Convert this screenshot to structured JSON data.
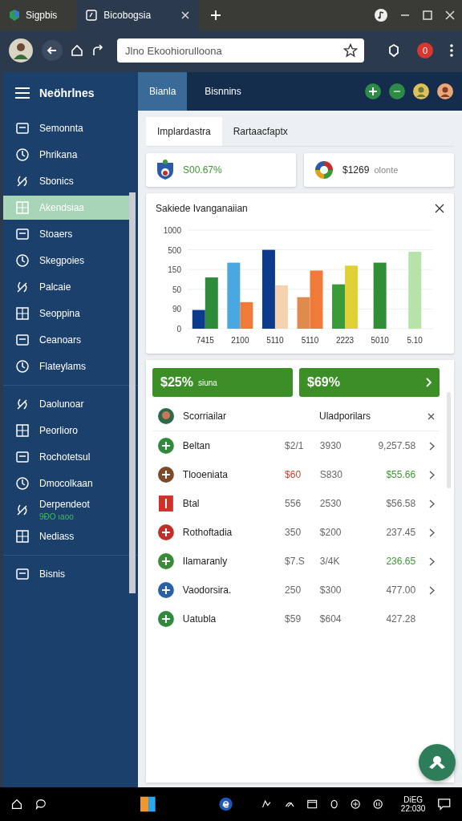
{
  "browser": {
    "tabs": [
      {
        "label": "Sigpbis",
        "selected": false
      },
      {
        "label": "Bicobogsia",
        "selected": true
      }
    ],
    "address": "Jlno Ekoohiorulloona",
    "notifications": "0"
  },
  "sidebar": {
    "title": "Neöhrlnes",
    "items": [
      {
        "label": "Semonnta",
        "selected": false
      },
      {
        "label": "Phrikana",
        "selected": false
      },
      {
        "label": "Sbonics",
        "selected": false
      },
      {
        "label": "Akendsiaa",
        "selected": true
      },
      {
        "label": "Stoaers",
        "selected": false
      },
      {
        "label": "Skegpoies",
        "selected": false
      },
      {
        "label": "Palcaie",
        "selected": false
      },
      {
        "label": "Seoppina",
        "selected": false
      },
      {
        "label": "Ceanoars",
        "selected": false
      },
      {
        "label": "Flateylams",
        "selected": false
      },
      {
        "label": "Daolunoar",
        "selected": false,
        "divider_before": true
      },
      {
        "label": "Peorlioro",
        "selected": false
      },
      {
        "label": "Rochotetsul",
        "selected": false
      },
      {
        "label": "Dmocolkaan",
        "selected": false
      },
      {
        "label": "Derpendeot",
        "selected": false,
        "sub": "9ÐO ıaoo"
      },
      {
        "label": "Nediass",
        "selected": false
      },
      {
        "label": "Bisnis",
        "selected": false,
        "divider_before": true
      }
    ]
  },
  "header_tabs": [
    {
      "label": "Bianla",
      "selected": true
    },
    {
      "label": "Bisnnins",
      "selected": false
    }
  ],
  "content_tabs": [
    {
      "label": "Implardastra",
      "selected": true
    },
    {
      "label": "Rartaacfaptx",
      "selected": false
    }
  ],
  "stats": [
    {
      "value": "S00.67%"
    },
    {
      "value": "$1269",
      "note": "olonte"
    }
  ],
  "chart_card": {
    "title": "Sakiede Ivanganaiian",
    "y_axis_labels": [
      "1000",
      "500",
      "150",
      "50",
      "90",
      "0"
    ],
    "x_axis_labels": [
      "7415",
      "2100",
      "5110",
      "5110",
      "2223",
      "5010",
      "5.10"
    ]
  },
  "actions": [
    {
      "value": "$25%",
      "note": "siuna",
      "chevron": false
    },
    {
      "value": "$69%",
      "chevron": true
    }
  ],
  "list": {
    "header": {
      "name": "Scorriailar",
      "column": "Uladporilars"
    },
    "rows": [
      {
        "name": "Beltan",
        "cells": [
          {
            "text": "$2/1",
            "color": "#666666"
          },
          {
            "text": "3930",
            "color": "#666666"
          },
          {
            "text": "9,257.58",
            "color": "#666666"
          }
        ],
        "chevron": true
      },
      {
        "name": "Tlooeniata",
        "cells": [
          {
            "text": "$60",
            "color": "#c9452a"
          },
          {
            "text": "S830",
            "color": "#666666"
          },
          {
            "text": "$55.66",
            "color": "#3a9a2e"
          }
        ],
        "chevron": true
      },
      {
        "name": "Btal",
        "cells": [
          {
            "text": "556",
            "color": "#666666"
          },
          {
            "text": "2530",
            "color": "#666666"
          },
          {
            "text": "$56.58",
            "color": "#666666"
          }
        ],
        "chevron": true
      },
      {
        "name": "Rothoftadia",
        "cells": [
          {
            "text": "350",
            "color": "#666666"
          },
          {
            "text": "$200",
            "color": "#666666"
          },
          {
            "text": "237.45",
            "color": "#666666"
          }
        ],
        "chevron": true
      },
      {
        "name": "Ilamaranly",
        "cells": [
          {
            "text": "$7.S",
            "color": "#666666"
          },
          {
            "text": "3/4K",
            "color": "#666666"
          },
          {
            "text": "236.65",
            "color": "#3a9a2e"
          }
        ],
        "chevron": true
      },
      {
        "name": "Vaodorsira.",
        "cells": [
          {
            "text": "250",
            "color": "#666666"
          },
          {
            "text": "$300",
            "color": "#666666"
          },
          {
            "text": "477.00",
            "color": "#666666"
          }
        ],
        "chevron": true
      },
      {
        "name": "Uatubla",
        "cells": [
          {
            "text": "$59",
            "color": "#666666"
          },
          {
            "text": "$604",
            "color": "#666666"
          },
          {
            "text": "427.28",
            "color": "#666666"
          }
        ],
        "chevron": false
      }
    ]
  },
  "taskbar": {
    "date": "DiEG",
    "time": "22:030"
  }
}
